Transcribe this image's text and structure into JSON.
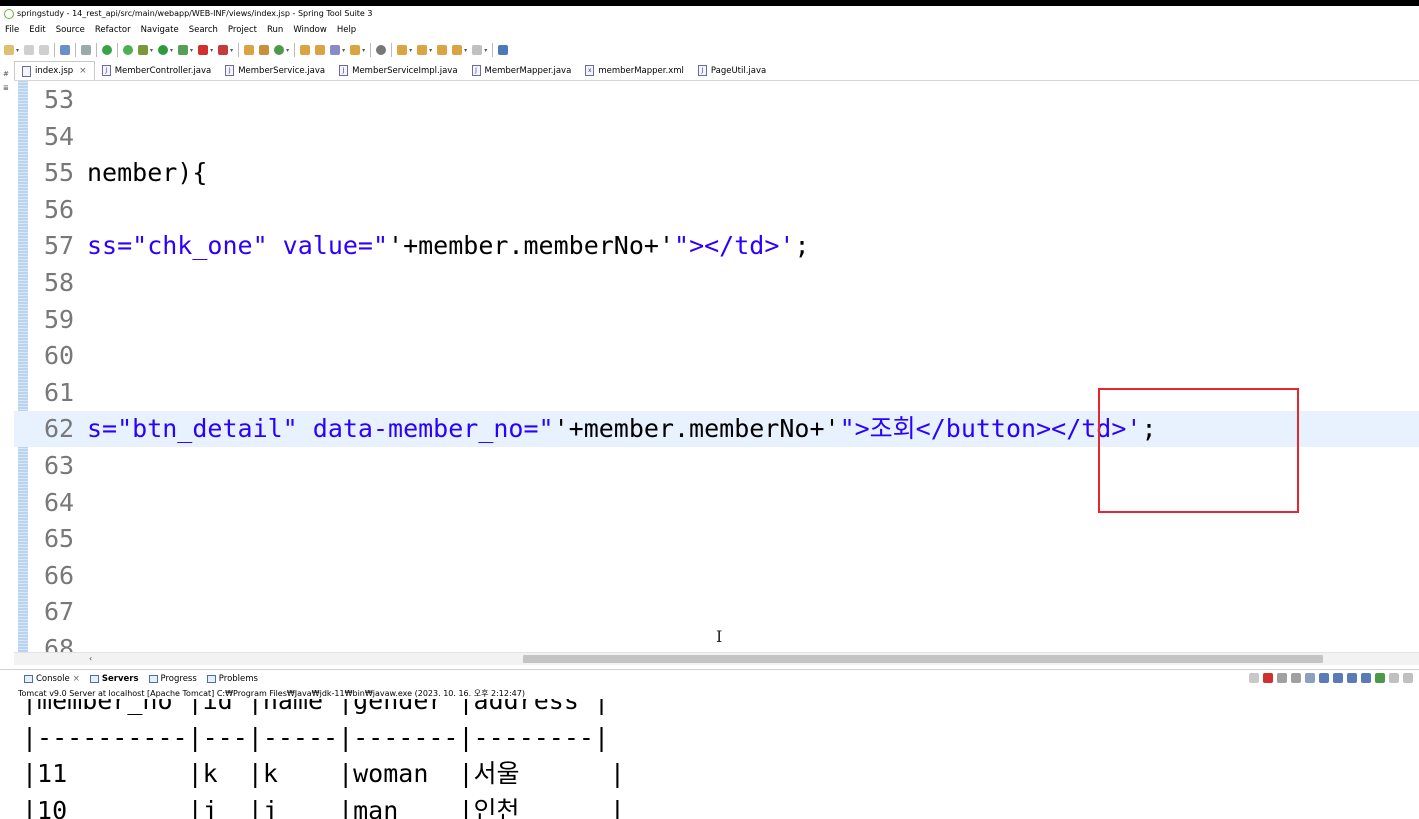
{
  "window": {
    "title": "springstudy - 14_rest_api/src/main/webapp/WEB-INF/views/index.jsp - Spring Tool Suite 3"
  },
  "menu": [
    "File",
    "Edit",
    "Source",
    "Refactor",
    "Navigate",
    "Search",
    "Project",
    "Run",
    "Window",
    "Help"
  ],
  "tabs": [
    {
      "label": "index.jsp",
      "active": true,
      "icon": "jsp-file-icon"
    },
    {
      "label": "MemberController.java",
      "active": false,
      "icon": "java-file-icon"
    },
    {
      "label": "MemberService.java",
      "active": false,
      "icon": "java-file-icon"
    },
    {
      "label": "MemberServiceImpl.java",
      "active": false,
      "icon": "java-file-icon"
    },
    {
      "label": "MemberMapper.java",
      "active": false,
      "icon": "java-file-icon"
    },
    {
      "label": "memberMapper.xml",
      "active": false,
      "icon": "xml-file-icon"
    },
    {
      "label": "PageUtil.java",
      "active": false,
      "icon": "java-file-icon"
    }
  ],
  "editor": {
    "lines": [
      {
        "num": "53",
        "parts": []
      },
      {
        "num": "54",
        "parts": []
      },
      {
        "num": "55",
        "parts": [
          {
            "t": "nember){",
            "c": "plain"
          }
        ]
      },
      {
        "num": "56",
        "parts": []
      },
      {
        "num": "57",
        "parts": [
          {
            "t": "ss=\"chk_one\" value=\"",
            "c": "str"
          },
          {
            "t": "'+member.memberNo+'",
            "c": "plain"
          },
          {
            "t": "\"></td>'",
            "c": "str"
          },
          {
            "t": ";",
            "c": "plain"
          }
        ]
      },
      {
        "num": "58",
        "parts": []
      },
      {
        "num": "59",
        "parts": []
      },
      {
        "num": "60",
        "parts": []
      },
      {
        "num": "61",
        "parts": []
      },
      {
        "num": "62",
        "parts": [
          {
            "t": "s=\"btn_detail\" data-member_no=\"",
            "c": "str"
          },
          {
            "t": "'+member.memberNo+'",
            "c": "plain"
          },
          {
            "t": "\">조회</button></td>'",
            "c": "str"
          },
          {
            "t": ";",
            "c": "plain"
          }
        ],
        "current": true
      },
      {
        "num": "63",
        "parts": []
      },
      {
        "num": "64",
        "parts": []
      },
      {
        "num": "65",
        "parts": []
      },
      {
        "num": "66",
        "parts": []
      },
      {
        "num": "67",
        "parts": []
      },
      {
        "num": "68",
        "parts": []
      }
    ]
  },
  "console": {
    "tabs": [
      {
        "label": "Console",
        "bold": false
      },
      {
        "label": "Servers",
        "bold": true
      },
      {
        "label": "Progress",
        "bold": false
      },
      {
        "label": "Problems",
        "bold": false
      }
    ],
    "server_line": "Tomcat v9.0 Server at localhost [Apache Tomcat] C:₩Program Files₩Java₩jdk-11₩bin₩javaw.exe  (2023. 10. 16. 오후 2:12:47)",
    "output": [
      "|member_no |id |name |gender |address |",
      "|----------|---|-----|-------|--------|",
      "|11        |k  |k    |woman  |서울      |",
      "|10        |j  |j    |man    |인천      |"
    ]
  },
  "colors": {
    "string": "#2a00ff",
    "current_line": "#e8f2fe",
    "highlight_box": "#e8262e"
  }
}
